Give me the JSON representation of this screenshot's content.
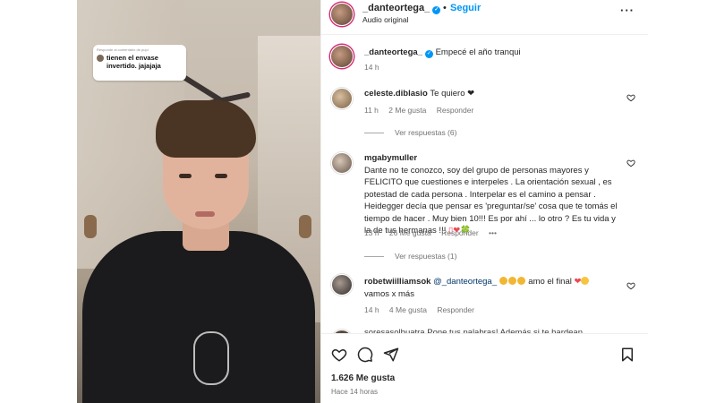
{
  "reply_sticker": {
    "title": "Responde al comentario de pupi",
    "text": "tienen el envase invertido. jajajaja"
  },
  "header": {
    "username": "_danteortega_",
    "follow_label": "Seguir",
    "separator": "•",
    "subtitle": "Audio original",
    "more_icon": "more-horizontal-icon"
  },
  "caption": {
    "username": "_danteortega_",
    "text": "Empecé el año tranqui",
    "time": "14 h"
  },
  "comments": [
    {
      "username": "celeste.diblasio",
      "text": "Te quiero ❤",
      "time": "11 h",
      "likes": "2 Me gusta",
      "reply": "Responder",
      "view_replies": "Ver respuestas (6)"
    },
    {
      "username": "mgabymuller",
      "text": "Dante no te conozco, soy del grupo de personas mayores y FELICITO que cuestiones e interpeles . La orientación sexual , es potestad de cada persona . Interpelar es el camino a pensar . Heidegger decía que pensar es 'preguntar/se' cosa que te tomás el tiempo de hacer . Muy bien 10!!! Es por ahí ... lo otro ? Es tu vida y la de tus hermanas !!! ",
      "text_tail": "▯❤🍀",
      "time": "13 h",
      "likes": "26 Me gusta",
      "reply": "Responder",
      "more": "•••",
      "view_replies": "Ver respuestas (1)"
    },
    {
      "username": "robetwiilliamsok",
      "mention": "@_danteortega_",
      "text_after": "amo el final",
      "text_line2": "vamos x más",
      "time": "14 h",
      "likes": "4 Me gusta",
      "reply": "Responder"
    }
  ],
  "cut_comment": "soresasolbuatra Pone tus palabras! Además si te hardean",
  "footer": {
    "likes": "1.626 Me gusta",
    "ago": "Hace 14 horas"
  },
  "colors": {
    "accent": "#0095f6",
    "heart": "#ed4956",
    "text": "#262626",
    "muted": "#737373"
  }
}
